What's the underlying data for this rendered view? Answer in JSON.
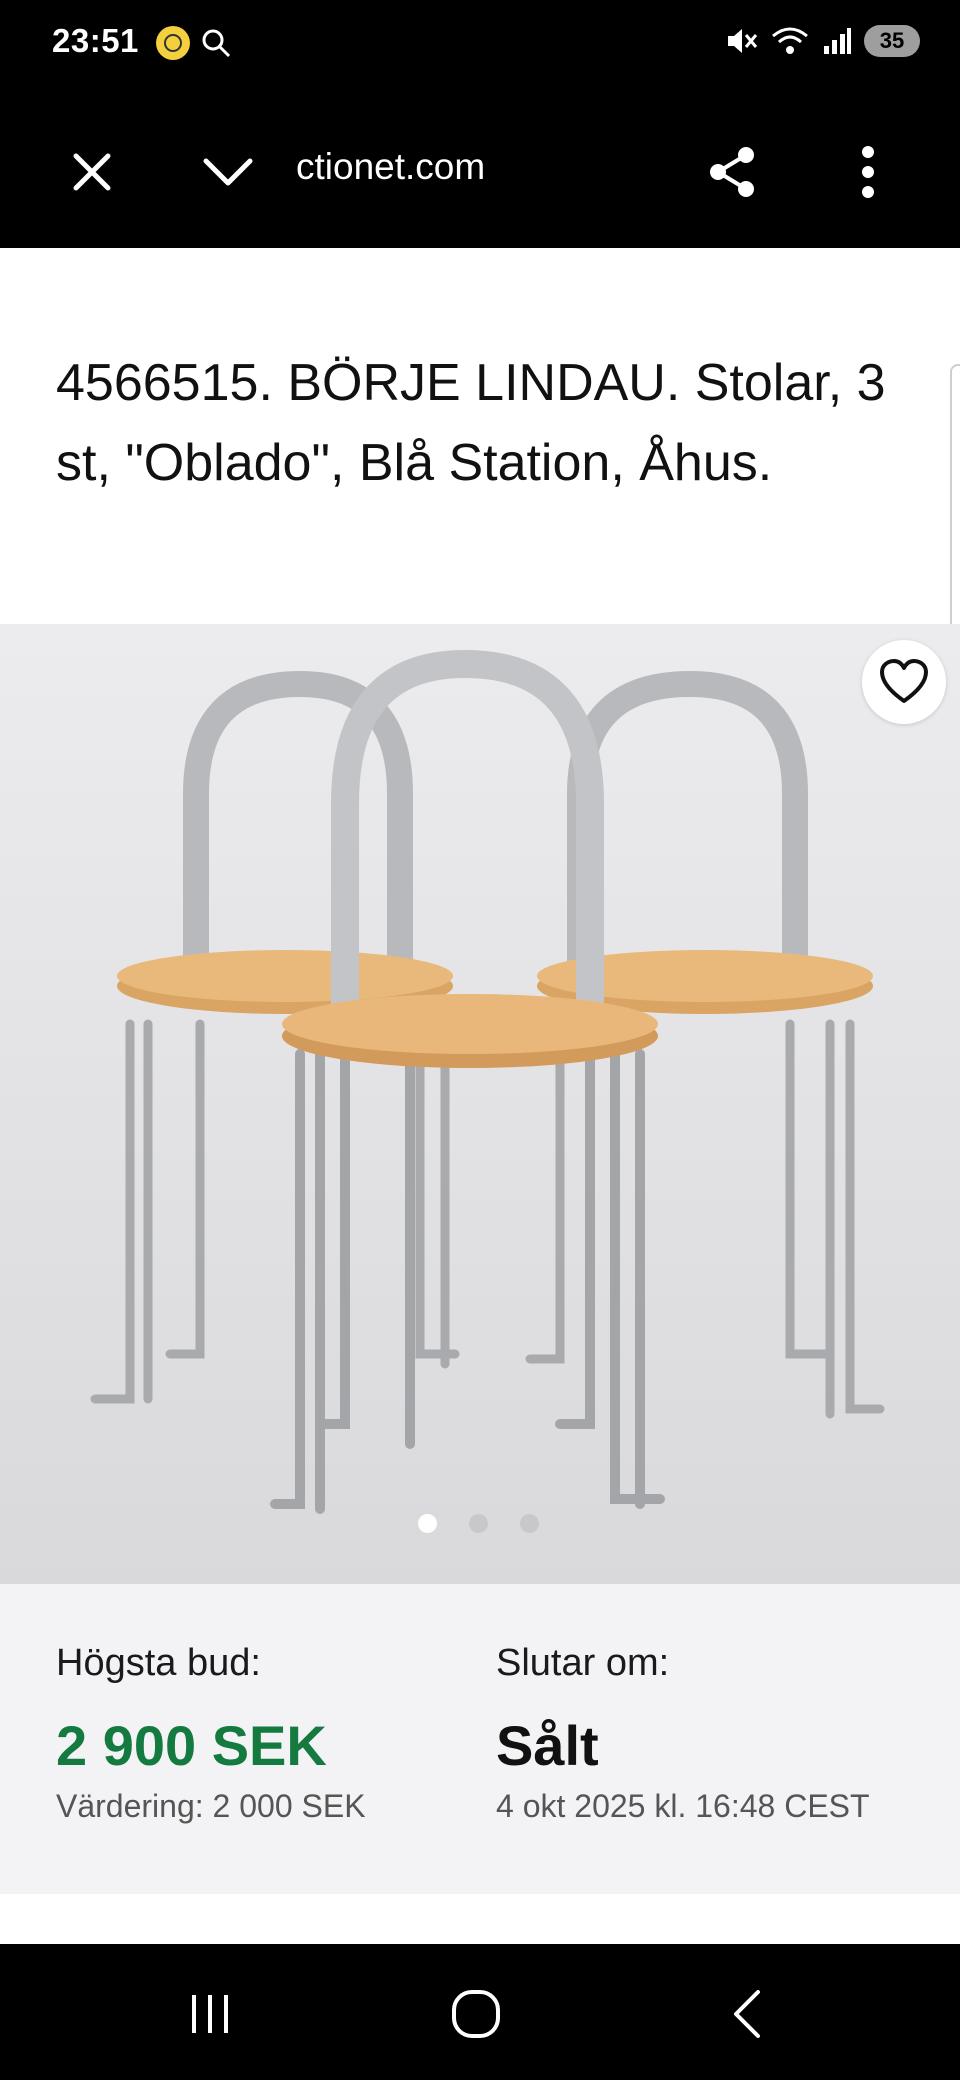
{
  "status": {
    "time": "23:51",
    "battery": "35"
  },
  "browser": {
    "url": "ctionet.com"
  },
  "item": {
    "title": "4566515. BÖRJE LINDAU. Stolar, 3 st, \"Oblado\", Blå Station, Åhus."
  },
  "bid": {
    "highest_label": "Högsta bud:",
    "highest_value": "2 900 SEK",
    "valuation": "Värdering: 2 000 SEK",
    "ends_label": "Slutar om:",
    "ends_status": "Sålt",
    "ends_date": "4 okt 2025 kl. 16:48 CEST"
  },
  "gallery": {
    "image_count": 3,
    "current": 1
  },
  "colors": {
    "price_green": "#157a3f",
    "bar_black": "#000000",
    "panel_gray": "#f3f3f5"
  },
  "icons": [
    "close-icon",
    "chevron-down-icon",
    "share-icon",
    "more-vert-icon",
    "heart-icon",
    "recent-apps-icon",
    "home-icon",
    "back-icon"
  ]
}
